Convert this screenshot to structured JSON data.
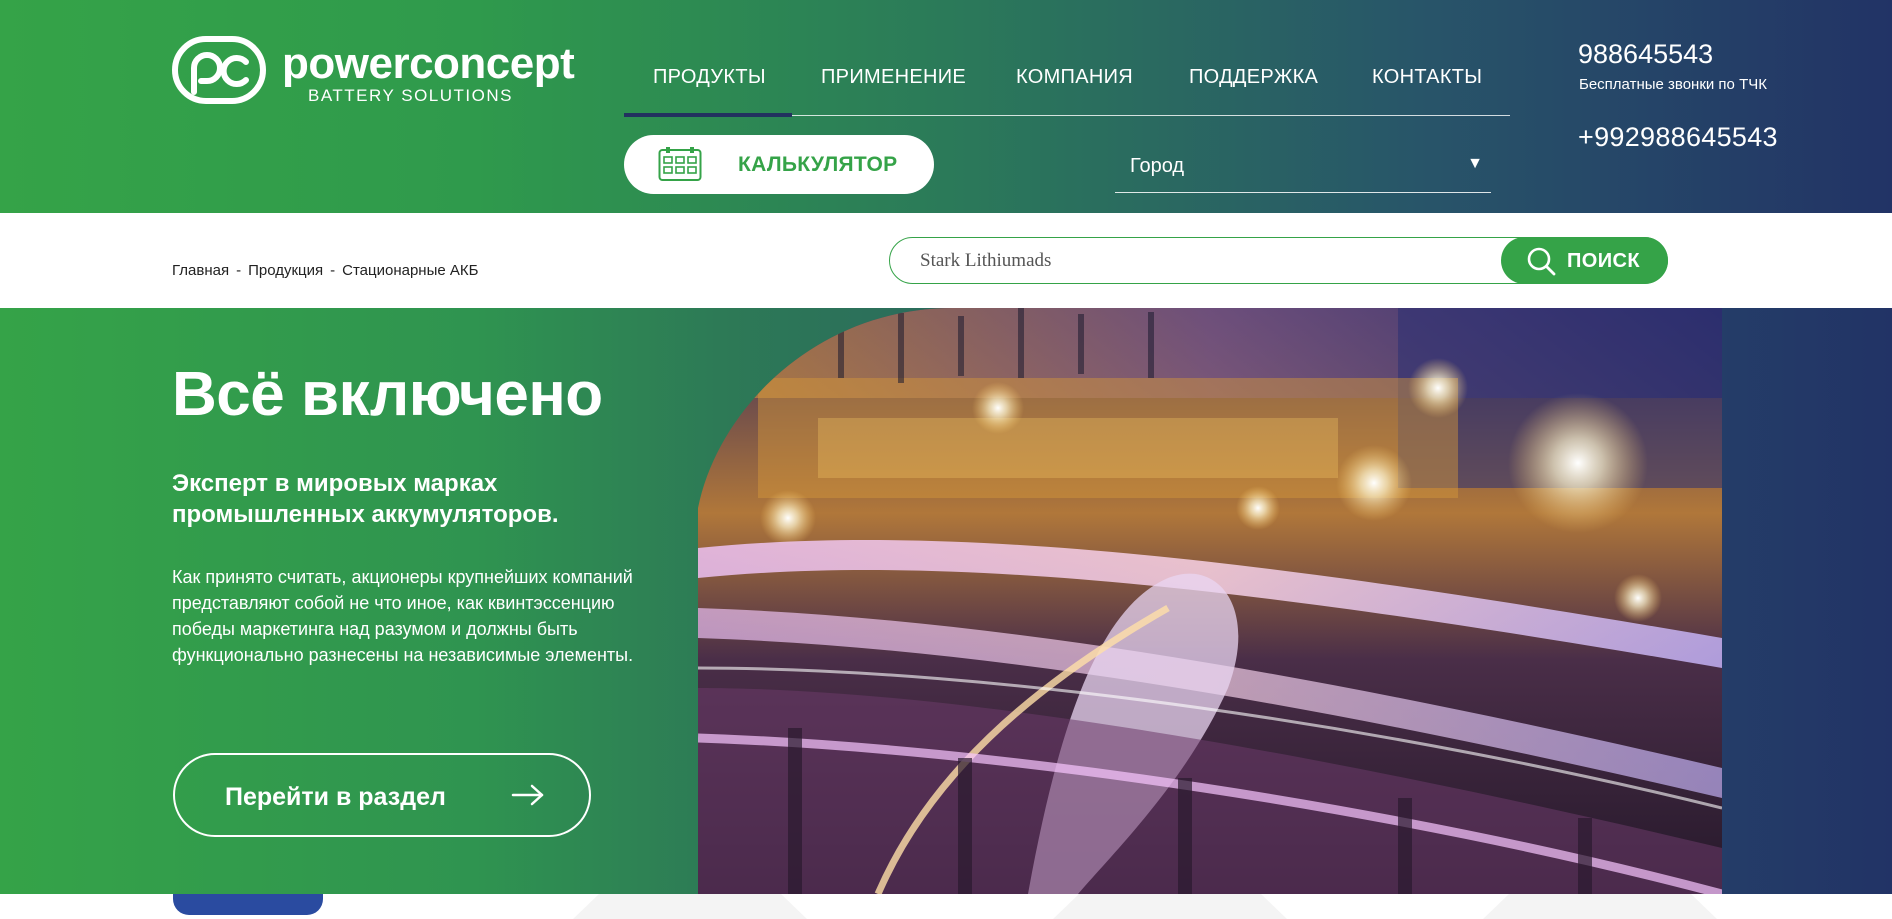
{
  "brand": {
    "name": "powerconcept",
    "tagline": "BATTERY SOLUTIONS"
  },
  "nav": {
    "items": [
      {
        "label": "ПРОДУКТЫ",
        "active": true
      },
      {
        "label": "ПРИМЕНЕНИЕ",
        "active": false
      },
      {
        "label": "КОМПАНИЯ",
        "active": false
      },
      {
        "label": "ПОДДЕРЖКА",
        "active": false
      },
      {
        "label": "КОНТАКТЫ",
        "active": false
      }
    ]
  },
  "calculator": {
    "label": "КАЛЬКУЛЯТОР",
    "icon": "calculator-icon"
  },
  "city_select": {
    "label": "Город",
    "icon": "caret-down-icon"
  },
  "contacts": {
    "phone_free": "988645543",
    "phone_free_note": "Бесплатные звонки по ТЧК",
    "phone_main": "+992988645543"
  },
  "breadcrumb": {
    "items": [
      "Главная",
      "Продукция",
      "Стационарные АКБ"
    ],
    "separator": "-"
  },
  "search": {
    "value": "Stark Lithiumads",
    "button_label": "ПОИСК",
    "icon": "search-icon"
  },
  "hero": {
    "title": "Всё включено",
    "subtitle": "Эксперт в мировых марках промышленных аккумуляторов.",
    "text": "Как принято считать, акционеры крупнейших компаний представляют собой не что иное, как квинтэссенцию победы маркетинга над разумом и должны быть функционально разнесены на независимые элементы.",
    "button_label": "Перейти в раздел",
    "button_icon": "arrow-right-icon",
    "image": "night-highway-port-photo"
  },
  "colors": {
    "brand_green": "#35a348",
    "brand_navy": "#223366",
    "active_bar": "#22315f",
    "accent_blue": "#2a4ba0"
  }
}
